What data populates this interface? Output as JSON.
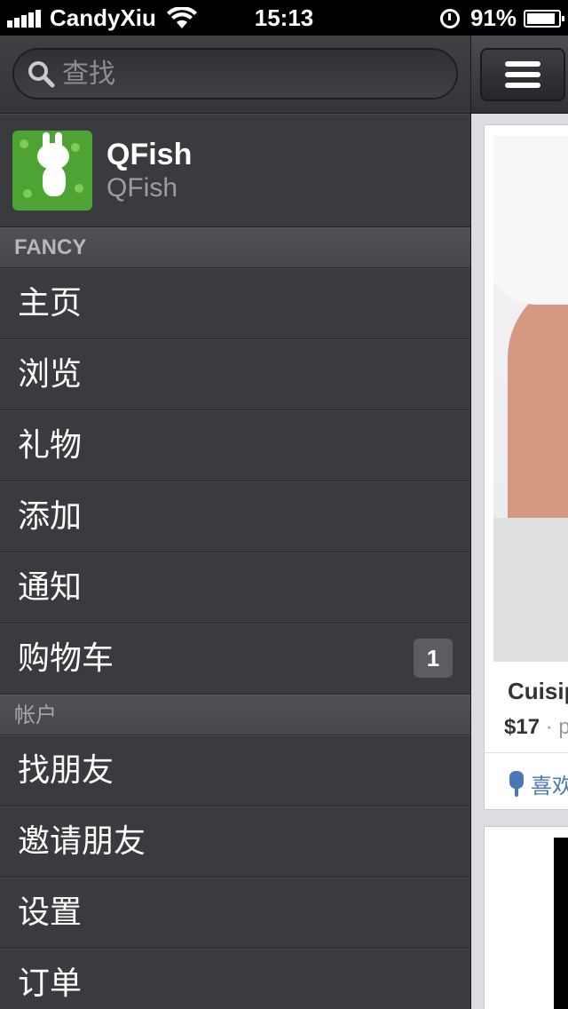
{
  "status_bar": {
    "carrier": "CandyXiu",
    "time": "15:13",
    "battery": "91%",
    "battery_level": 0.91
  },
  "search": {
    "placeholder": "查找",
    "icon": "search-icon"
  },
  "profile": {
    "name": "QFish",
    "username": "QFish"
  },
  "sections": {
    "fancy": {
      "header": "FANCY",
      "items": [
        {
          "label": "主页"
        },
        {
          "label": "浏览"
        },
        {
          "label": "礼物"
        },
        {
          "label": "添加"
        },
        {
          "label": "通知"
        },
        {
          "label": "购物车",
          "badge": "1"
        }
      ]
    },
    "account": {
      "header": "帐户",
      "items": [
        {
          "label": "找朋友"
        },
        {
          "label": "邀请朋友"
        },
        {
          "label": "设置"
        },
        {
          "label": "订单"
        }
      ]
    }
  },
  "content": {
    "menu_icon": "hamburger-icon",
    "card": {
      "title": "Cuisip",
      "price": "$17",
      "price_sep": "·",
      "price_suffix": "p",
      "like_label": "喜欢"
    }
  },
  "colors": {
    "sidebar_bg": "#3a3b3f",
    "section_header_bg": "#4c4d52",
    "like_blue": "#4a78b2",
    "badge_bg": "#5c5d62"
  }
}
